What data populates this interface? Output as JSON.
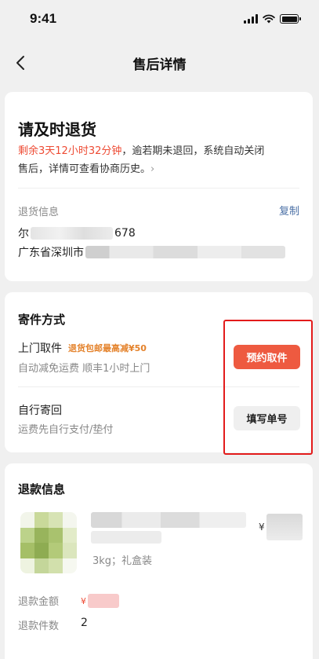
{
  "status_bar": {
    "time": "9:41"
  },
  "nav": {
    "title": "售后详情"
  },
  "return_card": {
    "title": "请及时退货",
    "countdown": "剩余3天12小时32分钟",
    "desc_line1": "，逾若期未退回，系统自动关闭",
    "desc_line2": "售后，详情可查看协商历史。",
    "address_label": "退货信息",
    "copy_label": "复制",
    "name_start": "尔",
    "name_end": "678",
    "address_start": "广东省深圳市"
  },
  "shipping": {
    "title": "寄件方式",
    "options": [
      {
        "title": "上门取件",
        "tag": "退货包邮最高减¥50",
        "subtitle": "自动减免运费 顺丰1小时上门",
        "button": "预约取件"
      },
      {
        "title": "自行寄回",
        "subtitle": "运费先自行支付/垫付",
        "button": "填写单号"
      }
    ]
  },
  "refund": {
    "title": "退款信息",
    "currency": "¥",
    "spec": "3kg；礼盒装",
    "amount_label": "退款金额",
    "count_label": "退款件数",
    "count": "2"
  },
  "colors": {
    "accent": "#ee5a40",
    "countdown": "#ee4b34",
    "tag": "#e4822b",
    "link": "#4a6fa5",
    "highlight": "#e31b1b"
  }
}
